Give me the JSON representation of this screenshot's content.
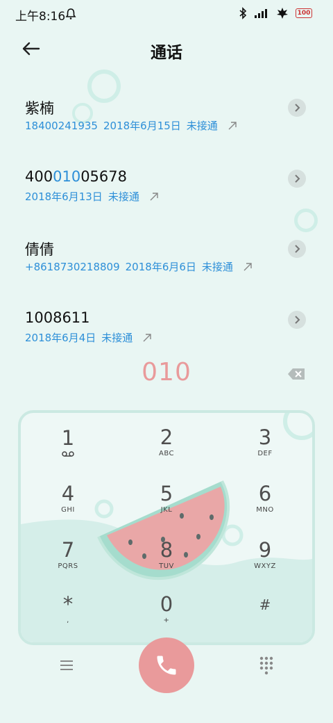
{
  "status_bar": {
    "time": "上午8:16",
    "battery": "100"
  },
  "header": {
    "title": "通话"
  },
  "calls": [
    {
      "name": "紫楠",
      "number": "18400241935",
      "date": "2018年6月15日",
      "status": "未接通"
    },
    {
      "name_pre": "400",
      "name_hl": "010",
      "name_post": "05678",
      "date": "2018年6月13日",
      "status": "未接通"
    },
    {
      "name": "倩倩",
      "number": "+8618730218809",
      "date": "2018年6月6日",
      "status": "未接通"
    },
    {
      "name": "1008611",
      "date": "2018年6月4日",
      "status": "未接通"
    }
  ],
  "dialer": {
    "input": "010",
    "keys": [
      {
        "digit": "1",
        "sub": ""
      },
      {
        "digit": "2",
        "sub": "ABC"
      },
      {
        "digit": "3",
        "sub": "DEF"
      },
      {
        "digit": "4",
        "sub": "GHI"
      },
      {
        "digit": "5",
        "sub": "JKL"
      },
      {
        "digit": "6",
        "sub": "MNO"
      },
      {
        "digit": "7",
        "sub": "PQRS"
      },
      {
        "digit": "8",
        "sub": "TUV"
      },
      {
        "digit": "9",
        "sub": "WXYZ"
      },
      {
        "digit": "*",
        "sub": ","
      },
      {
        "digit": "0",
        "sub": "+"
      },
      {
        "digit": "#",
        "sub": ""
      }
    ]
  },
  "colors": {
    "background": "#e9f6f3",
    "accent_blue": "#2d8fd8",
    "accent_pink": "#e99a9b",
    "panel_border": "#cbe9e2"
  },
  "icons": {
    "back": "arrow-left-icon",
    "detail": "chevron-right-icon",
    "call_type": "outgoing-arrow-icon",
    "backspace": "backspace-icon",
    "menu": "menu-icon",
    "call": "phone-icon",
    "dialpad": "dialpad-icon",
    "voicemail": "voicemail-icon"
  }
}
